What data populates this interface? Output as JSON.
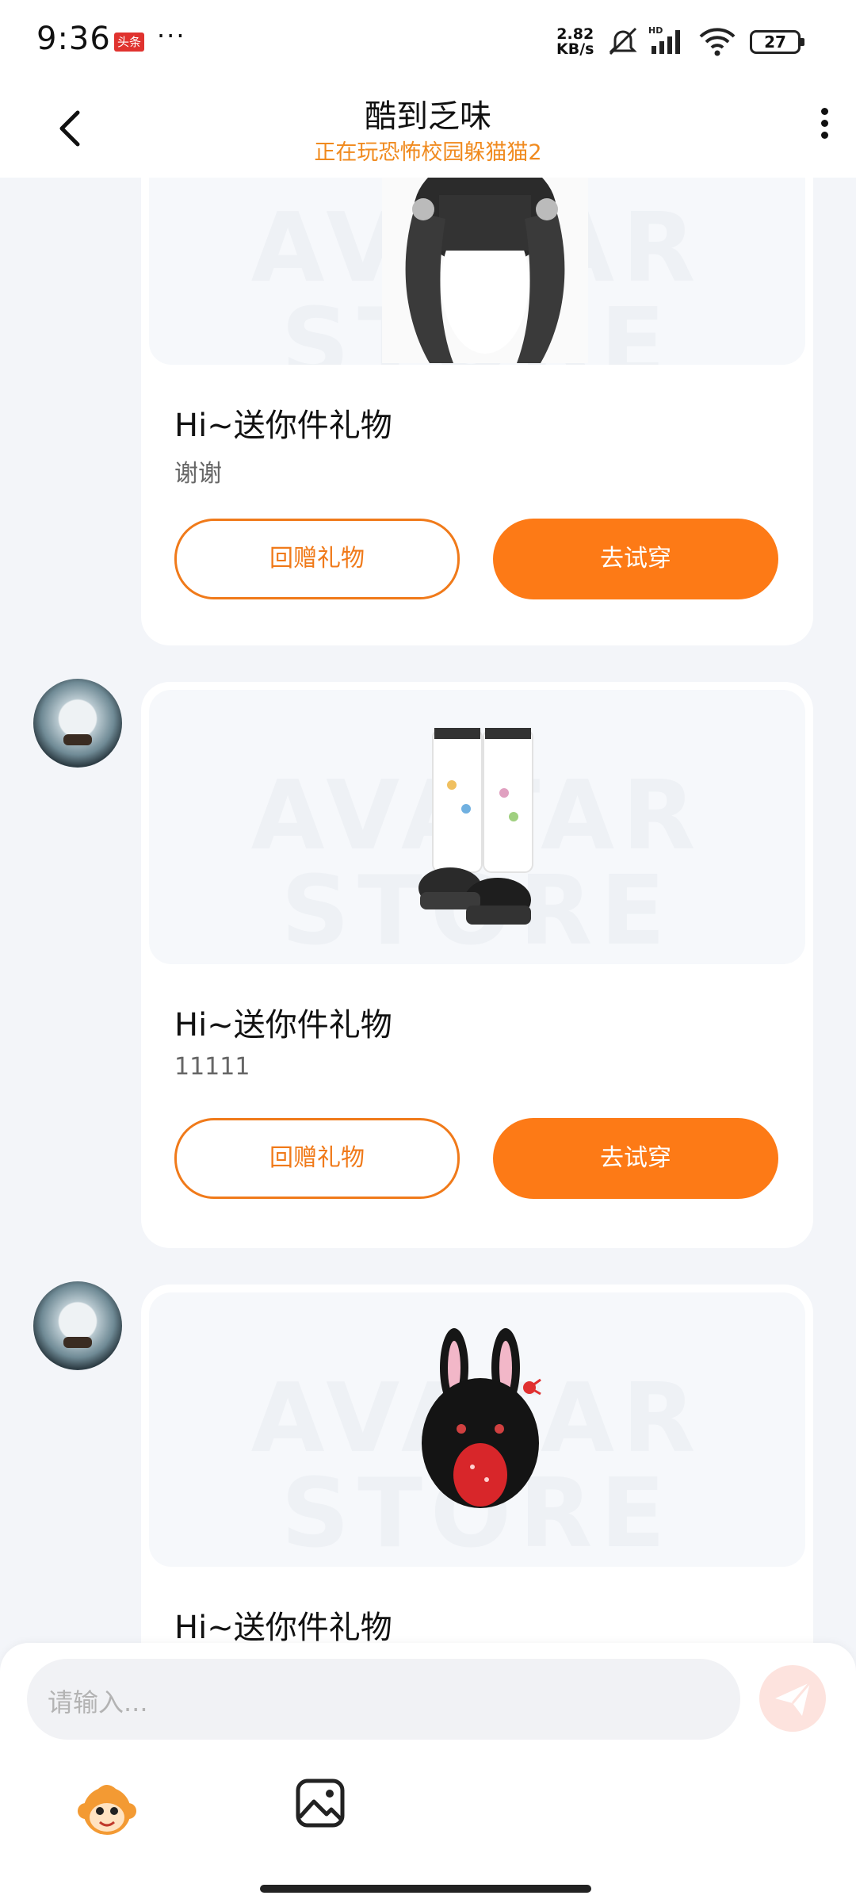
{
  "status_bar": {
    "time": "9:36",
    "app_badge": "头条",
    "more_dots": "···",
    "speed_value": "2.82",
    "speed_unit": "KB/s",
    "battery": "27"
  },
  "header": {
    "title": "酷到乏味",
    "subtitle": "正在玩恐怖校园躲猫猫2"
  },
  "watermark": {
    "line1": "AVATAR",
    "line2": "STORE"
  },
  "messages": [
    {
      "title": "Hi~送你件礼物",
      "message": "谢谢",
      "return_gift_label": "回赠礼物",
      "try_on_label": "去试穿",
      "item": "hair-icon"
    },
    {
      "title": "Hi~送你件礼物",
      "message": "11111",
      "return_gift_label": "回赠礼物",
      "try_on_label": "去试穿",
      "item": "boots-icon"
    },
    {
      "title": "Hi~送你件礼物",
      "item": "black-bunny-icon"
    }
  ],
  "composer": {
    "placeholder": "请输入..."
  },
  "colors": {
    "accent": "#fd7a16",
    "subtitle": "#f08a1e",
    "background": "#f3f5f9"
  }
}
